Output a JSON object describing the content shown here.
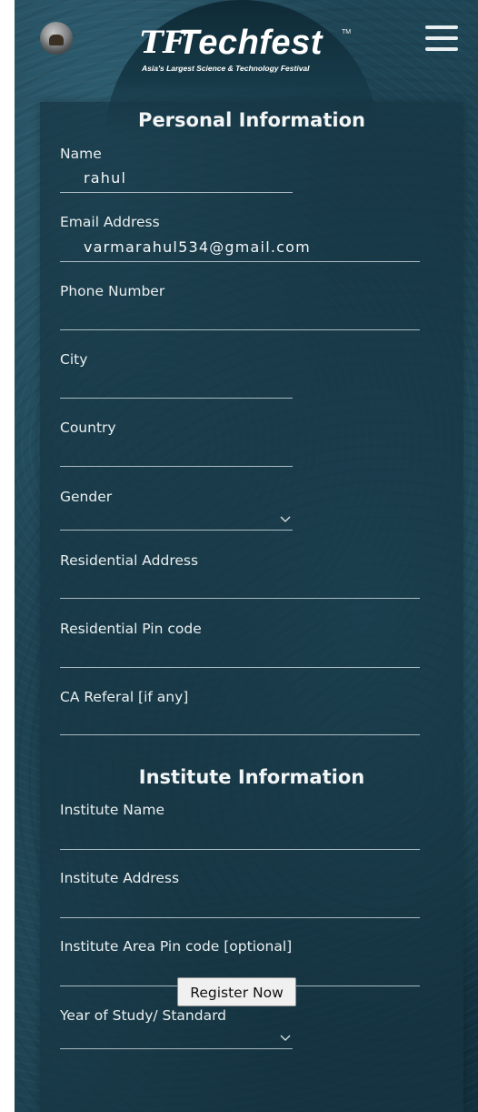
{
  "header": {
    "logo_mark": "TF",
    "logo_text": "Techfest",
    "logo_tm": "TM",
    "tagline": "Asia's Largest Science & Technology Festival",
    "avatar_icon": "user-avatar",
    "menu_icon": "hamburger-menu-icon"
  },
  "personal": {
    "title": "Personal Information",
    "name_label": "Name",
    "name_value": "rahul",
    "email_label": "Email Address",
    "email_value": "varmarahul534@gmail.com",
    "phone_label": "Phone Number",
    "phone_value": "",
    "city_label": "City",
    "city_value": "",
    "country_label": "Country",
    "country_value": "",
    "gender_label": "Gender",
    "gender_value": "",
    "address_label": "Residential Address",
    "address_value": "",
    "pin_label": "Residential Pin code",
    "pin_value": "",
    "ca_label": "CA Referal [if any]",
    "ca_value": ""
  },
  "institute": {
    "title": "Institute Information",
    "name_label": "Institute Name",
    "name_value": "",
    "address_label": "Institute Address",
    "address_value": "",
    "pin_label": "Institute Area Pin code [optional]",
    "pin_value": "",
    "year_label": "Year of Study/ Standard",
    "year_value": ""
  },
  "actions": {
    "register_label": "Register Now"
  },
  "colors": {
    "background": "#1a3e4d",
    "panel": "#163442",
    "text": "#e8eeef",
    "button_bg": "#f0f0f0"
  }
}
